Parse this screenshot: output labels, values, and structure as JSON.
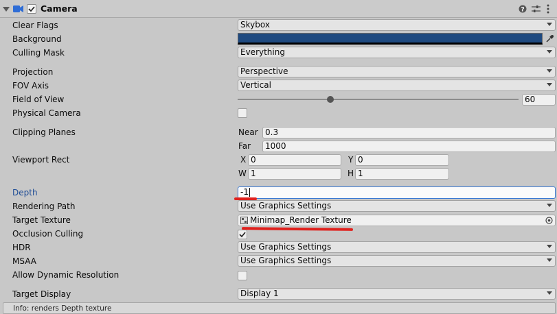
{
  "header": {
    "title": "Camera",
    "enabled": true
  },
  "rows": {
    "clear_flags": {
      "label": "Clear Flags",
      "value": "Skybox"
    },
    "background": {
      "label": "Background",
      "color": "#1f4a80"
    },
    "culling_mask": {
      "label": "Culling Mask",
      "value": "Everything"
    },
    "projection": {
      "label": "Projection",
      "value": "Perspective"
    },
    "fov_axis": {
      "label": "FOV Axis",
      "value": "Vertical"
    },
    "field_of_view": {
      "label": "Field of View",
      "value": "60",
      "slider_fraction": 0.331
    },
    "physical_camera": {
      "label": "Physical Camera",
      "checked": false
    },
    "clipping_planes": {
      "label": "Clipping Planes",
      "near_label": "Near",
      "near": "0.3",
      "far_label": "Far",
      "far": "1000"
    },
    "viewport_rect": {
      "label": "Viewport Rect",
      "x_label": "X",
      "x": "0",
      "y_label": "Y",
      "y": "0",
      "w_label": "W",
      "w": "1",
      "h_label": "H",
      "h": "1"
    },
    "depth": {
      "label": "Depth",
      "value": "-1"
    },
    "rendering_path": {
      "label": "Rendering Path",
      "value": "Use Graphics Settings"
    },
    "target_texture": {
      "label": "Target Texture",
      "value": "Minimap_Render Texture"
    },
    "occlusion_culling": {
      "label": "Occlusion Culling",
      "checked": true
    },
    "hdr": {
      "label": "HDR",
      "value": "Use Graphics Settings"
    },
    "msaa": {
      "label": "MSAA",
      "value": "Use Graphics Settings"
    },
    "allow_dynamic_resolution": {
      "label": "Allow Dynamic Resolution",
      "checked": false
    },
    "target_display": {
      "label": "Target Display",
      "value": "Display 1"
    }
  },
  "info": {
    "text": "Info: renders Depth texture"
  },
  "colors": {
    "accent_label": "#1f4d96",
    "annotation": "#e0211d",
    "camera_icon": "#2f6dd6"
  },
  "icons": {
    "fold": "triangle-down",
    "component": "camera-icon",
    "help": "help-icon",
    "presets": "sliders-icon",
    "menu": "kebab-menu-icon",
    "eyedropper": "eyedropper-icon",
    "object_picker": "target-icon",
    "texture": "texture-icon"
  }
}
